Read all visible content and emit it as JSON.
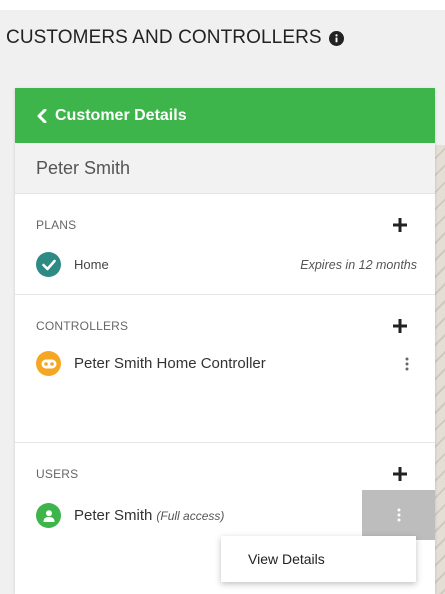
{
  "header": {
    "title": "CUSTOMERS AND CONTROLLERS",
    "info_icon": "info-icon"
  },
  "panel": {
    "back_label": "Customer Details",
    "back_icon": "chevron-left-icon",
    "customer_name": "Peter Smith",
    "accent_color": "#3db54a",
    "plans": {
      "label": "PLANS",
      "add_icon": "plus-icon",
      "items": [
        {
          "name": "Home",
          "expiry": "Expires in 12 months",
          "icon": "check-icon",
          "color": "#2e8a84"
        }
      ]
    },
    "controllers": {
      "label": "CONTROLLERS",
      "add_icon": "plus-icon",
      "items": [
        {
          "name": "Peter Smith Home Controller",
          "icon": "controller-icon",
          "color": "#f5a623",
          "menu_icon": "kebab-icon"
        }
      ]
    },
    "users": {
      "label": "USERS",
      "add_icon": "plus-icon",
      "items": [
        {
          "name": "Peter Smith",
          "access": "(Full access)",
          "icon": "user-icon",
          "color": "#3db54a",
          "menu_icon": "kebab-icon"
        }
      ]
    }
  },
  "context_menu": {
    "items": [
      {
        "label": "View Details"
      }
    ]
  }
}
